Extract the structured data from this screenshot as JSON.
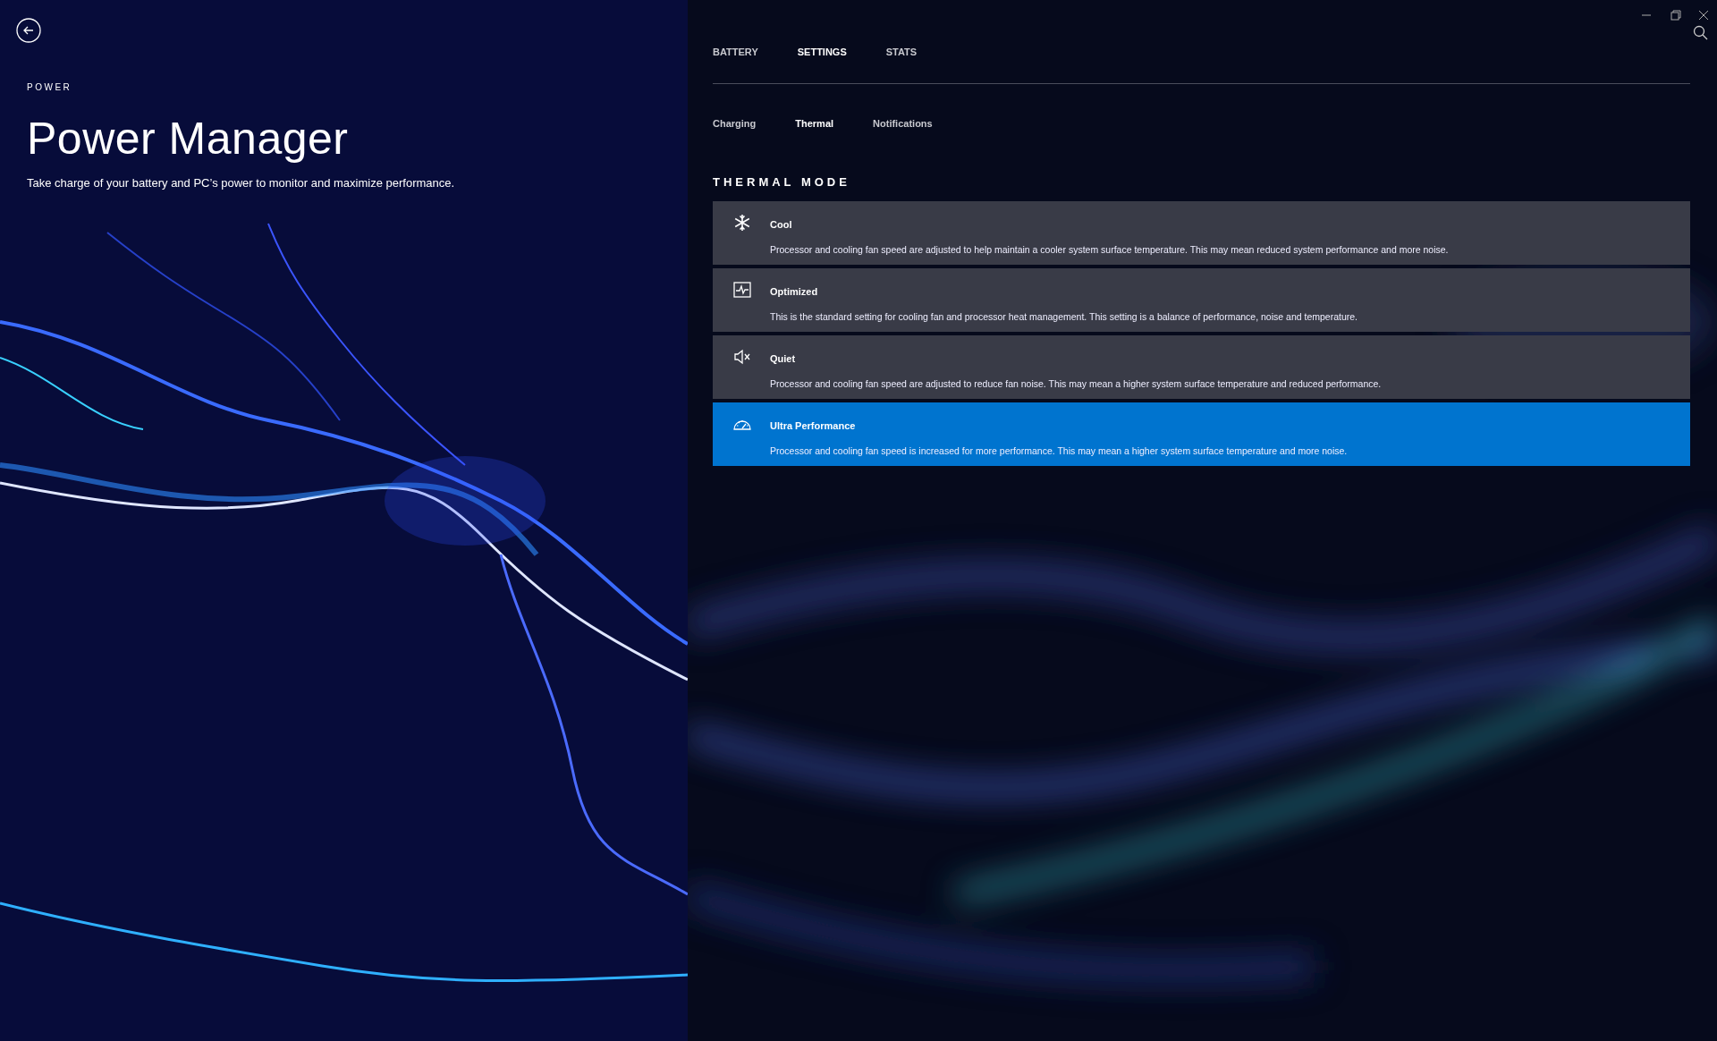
{
  "header": {
    "section": "POWER",
    "title": "Power Manager",
    "subtitle": "Take charge of your battery and PC’s power to monitor and maximize performance."
  },
  "tabs": [
    {
      "label": "BATTERY",
      "selected": false
    },
    {
      "label": "SETTINGS",
      "selected": true
    },
    {
      "label": "STATS",
      "selected": false
    }
  ],
  "subtabs": [
    {
      "label": "Charging",
      "selected": false
    },
    {
      "label": "Thermal",
      "selected": true
    },
    {
      "label": "Notifications",
      "selected": false
    }
  ],
  "thermal_mode": {
    "heading": "THERMAL MODE",
    "modes": [
      {
        "title": "Cool",
        "description": "Processor and cooling fan speed are adjusted to help maintain a cooler system surface temperature. This may mean reduced system performance and more noise.",
        "selected": false
      },
      {
        "title": "Optimized",
        "description": "This is the standard setting for cooling fan and processor heat management. This setting is a balance of performance, noise and temperature.",
        "selected": false
      },
      {
        "title": "Quiet",
        "description": "Processor and cooling fan speed are adjusted to reduce fan noise. This may mean a higher system surface temperature and reduced performance.",
        "selected": false
      },
      {
        "title": "Ultra Performance",
        "description": "Processor and cooling fan speed is increased for more performance. This may mean a higher system surface temperature and more noise.",
        "selected": true
      }
    ]
  }
}
